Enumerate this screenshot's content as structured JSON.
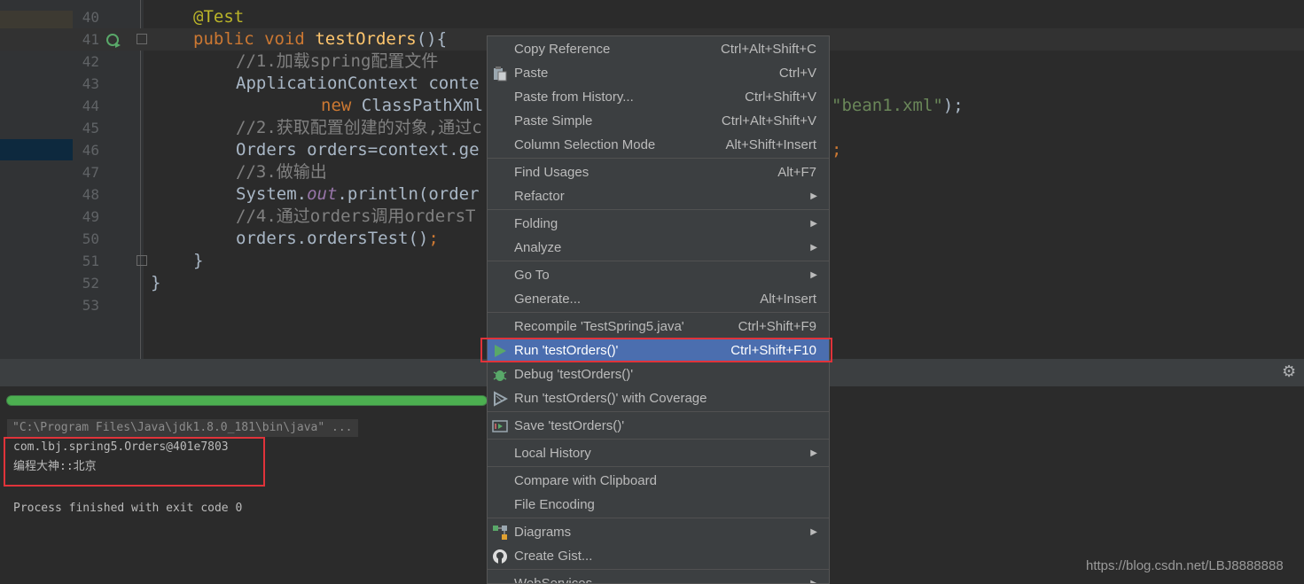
{
  "editor": {
    "lines": [
      {
        "num": "40",
        "annotation": "@Test"
      },
      {
        "num": "41",
        "kw1": "public",
        "kw2": "void",
        "fn": "testOrders",
        "rest": "(){"
      },
      {
        "num": "42",
        "comment": "//1.加载spring配置文件"
      },
      {
        "num": "43",
        "text": "ApplicationContext conte"
      },
      {
        "num": "44",
        "kw": "new",
        "text": " ClassPathXml",
        "str": "\"bean1.xml\"",
        "tail": ");"
      },
      {
        "num": "45",
        "comment": "//2.获取配置创建的对象,通过c"
      },
      {
        "num": "46",
        "text": "Orders orders=context.ge"
      },
      {
        "num": "47",
        "comment": "//3.做输出"
      },
      {
        "num": "48",
        "text_a": "System.",
        "it": "out",
        "text_b": ".println(order"
      },
      {
        "num": "49",
        "comment": "//4.通过orders调用ordersT"
      },
      {
        "num": "50",
        "text": "orders.ordersTest()",
        "semi": ";"
      },
      {
        "num": "51",
        "text": "}"
      },
      {
        "num": "52",
        "text": "}"
      },
      {
        "num": "53",
        "text": ""
      }
    ],
    "line46_tail": ";"
  },
  "run_panel": {
    "command": "\"C:\\Program Files\\Java\\jdk1.8.0_181\\bin\\java\" ...",
    "output_line1": "com.lbj.spring5.Orders@401e7803",
    "output_line2": "编程大神::北京",
    "exit_message": "Process finished with exit code 0",
    "gear_icon": "⚙",
    "progress": 1.0
  },
  "context_menu": {
    "items": [
      {
        "label": "Copy Reference",
        "shortcut": "Ctrl+Alt+Shift+C"
      },
      {
        "label": "Paste",
        "shortcut": "Ctrl+V",
        "icon": "clipboard-icon"
      },
      {
        "label": "Paste from History...",
        "shortcut": "Ctrl+Shift+V"
      },
      {
        "label": "Paste Simple",
        "shortcut": "Ctrl+Alt+Shift+V"
      },
      {
        "label": "Column Selection Mode",
        "shortcut": "Alt+Shift+Insert"
      },
      {
        "label": "Find Usages",
        "shortcut": "Alt+F7"
      },
      {
        "label": "Refactor",
        "submenu": true
      },
      {
        "label": "Folding",
        "submenu": true
      },
      {
        "label": "Analyze",
        "submenu": true
      },
      {
        "label": "Go To",
        "submenu": true
      },
      {
        "label": "Generate...",
        "shortcut": "Alt+Insert"
      },
      {
        "label": "Recompile 'TestSpring5.java'",
        "shortcut": "Ctrl+Shift+F9"
      },
      {
        "label": "Run 'testOrders()'",
        "shortcut": "Ctrl+Shift+F10",
        "icon": "run-icon",
        "selected": true
      },
      {
        "label": "Debug 'testOrders()'",
        "icon": "debug-icon"
      },
      {
        "label": "Run 'testOrders()' with Coverage",
        "icon": "coverage-icon"
      },
      {
        "label": "Save 'testOrders()'",
        "icon": "save-config-icon"
      },
      {
        "label": "Local History",
        "submenu": true
      },
      {
        "label": "Compare with Clipboard"
      },
      {
        "label": "File Encoding"
      },
      {
        "label": "Diagrams",
        "submenu": true,
        "icon": "diagrams-icon"
      },
      {
        "label": "Create Gist...",
        "icon": "github-icon"
      },
      {
        "label": "WebServices",
        "submenu": true
      }
    ],
    "submenu_arrow": "▶"
  },
  "watermark": "https://blog.csdn.net/LBJ8888888",
  "colors": {
    "selection": "#4b6eaf",
    "highlight_box": "#e0333a",
    "keyword": "#cc7832",
    "string": "#6a8759",
    "comment": "#808080"
  }
}
